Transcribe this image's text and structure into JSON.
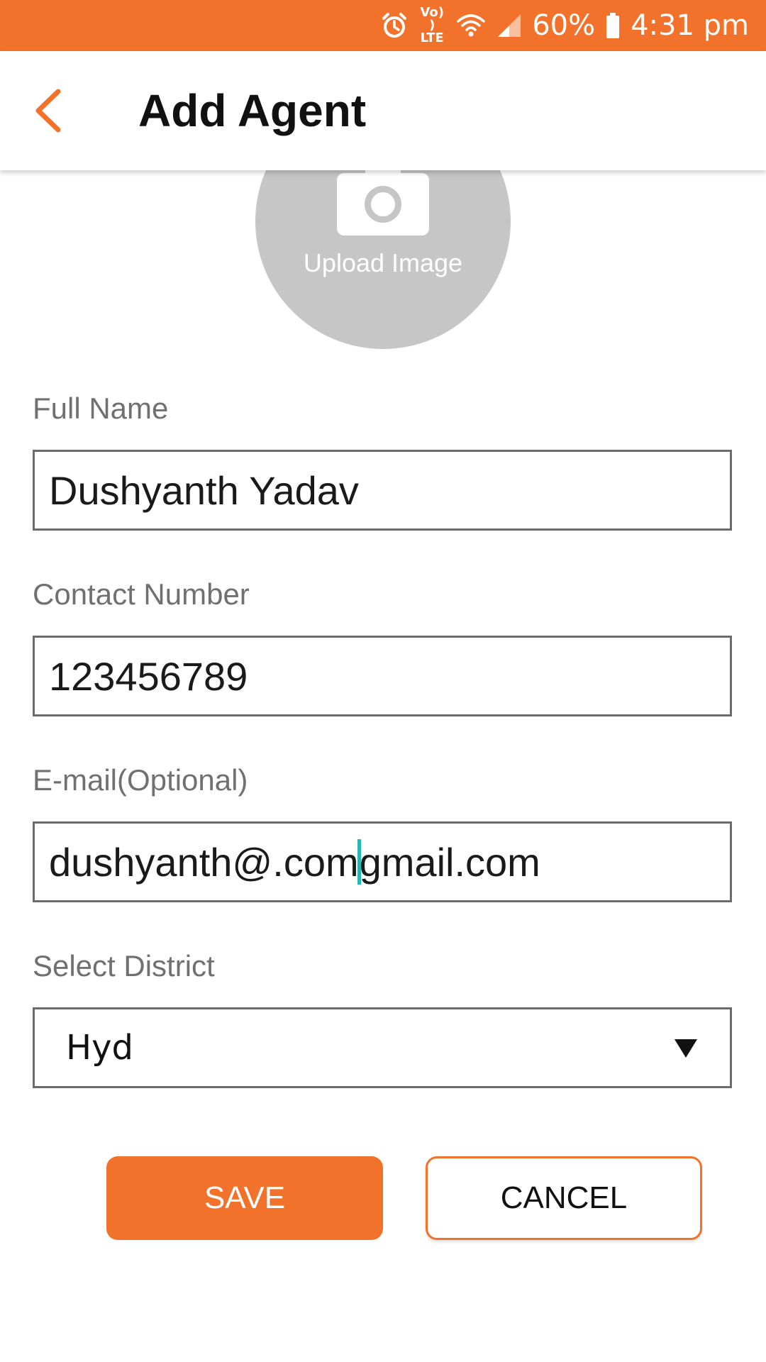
{
  "status_bar": {
    "battery": "60%",
    "time": "4:31 pm",
    "network_label": "Vo)) LTE",
    "icons": [
      "alarm-icon",
      "volte-icon",
      "wifi-icon",
      "signal-icon",
      "battery-icon"
    ]
  },
  "app_bar": {
    "back_icon": "chevron-left-icon",
    "title": "Add Agent"
  },
  "upload": {
    "icon": "camera-icon",
    "label": "Upload Image"
  },
  "form": {
    "full_name": {
      "label": "Full Name",
      "value": "Dushyanth Yadav"
    },
    "contact_number": {
      "label": "Contact Number",
      "value": "123456789"
    },
    "email": {
      "label": "E-mail(Optional)",
      "value_before_cursor": "dushyanth@.com",
      "value_after_cursor": "gmail.com"
    },
    "district": {
      "label": "Select District",
      "value": "Hyd"
    }
  },
  "actions": {
    "save_label": "SAVE",
    "cancel_label": "CANCEL"
  },
  "colors": {
    "accent": "#f2722b",
    "cursor": "#26b8b0",
    "upload_bg": "#c6c6c6"
  }
}
